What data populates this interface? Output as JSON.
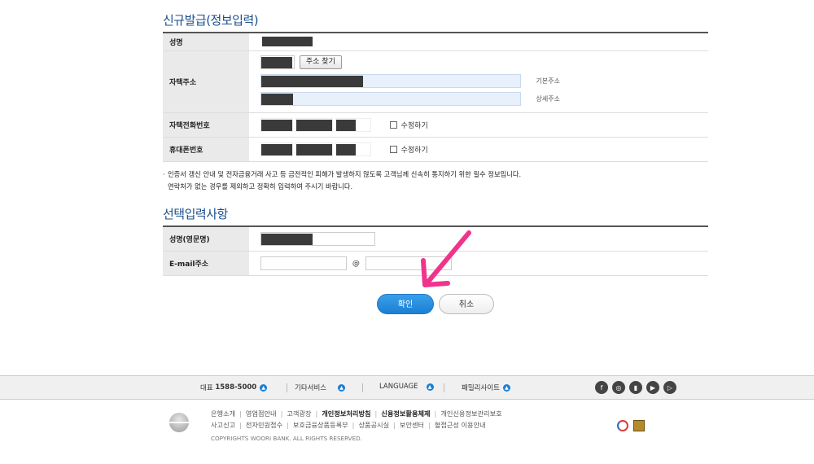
{
  "section1": {
    "title": "신규발급(정보입력)",
    "rows": {
      "name_label": "성명",
      "address_label": "자택주소",
      "address_search_btn": "주소 찾기",
      "address_basic_tag": "기본주소",
      "address_detail_tag": "상세주소",
      "home_phone_label": "자택전화번호",
      "mobile_label": "휴대폰번호",
      "edit_checkbox": "수정하기"
    },
    "notice_line1": "인증서 갱신 안내 및 전자금융거래 사고 등 금전적인 피해가 발생하지 않도록 고객님께 신속히 통지하기 위한 필수 정보입니다.",
    "notice_line2": "연락처가 없는 경우를 제외하고 정확히 입력하여 주시기 바랍니다."
  },
  "section2": {
    "title": "선택입력사항",
    "english_name_label": "성명(영문명)",
    "email_label": "E-mail주소",
    "at_sign": "@"
  },
  "buttons": {
    "confirm": "확인",
    "cancel": "취소"
  },
  "footer": {
    "rep_label": "대표",
    "rep_number": "1588-5000",
    "other_services": "기타서비스",
    "language": "LANGUAGE",
    "family_sites": "패밀리사이트",
    "social_icons": [
      "facebook-icon",
      "instagram-icon",
      "podcast-icon",
      "youtube-icon",
      "play-icon"
    ],
    "links_row1": [
      "은행소개",
      "영업점안내",
      "고객광장",
      "개인정보처리방침",
      "신용정보활용체제",
      "개인신용정보관리보호"
    ],
    "links_row2": [
      "사고신고",
      "전자민원접수",
      "보호금융상품등록부",
      "상품공시실",
      "보안센터",
      "혈접근성 이용안내"
    ],
    "copyright": "COPYRIGHTS WOORI BANK. ALL RIGHTS RESERVED."
  },
  "colors": {
    "accent": "#1a7fd4",
    "title": "#1a4f8b",
    "arrow": "#f0348c"
  }
}
